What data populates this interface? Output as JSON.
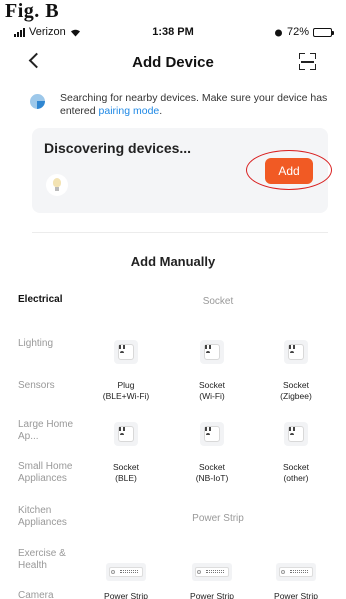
{
  "figure_label": "Fig. B",
  "status_bar": {
    "carrier": "Verizon",
    "time": "1:38 PM",
    "battery": "72%",
    "battery_level": 0.72
  },
  "nav": {
    "title": "Add Device",
    "back_icon": "chevron-left-icon",
    "scan_icon": "scan-icon"
  },
  "search": {
    "text": "Searching for nearby devices. Make sure your device has entered",
    "link": "pairing mode",
    "suffix": "."
  },
  "discover": {
    "title": "Discovering devices...",
    "device_icon": "light-bulb-icon",
    "add_label": "Add"
  },
  "manual": {
    "title": "Add Manually"
  },
  "categories": [
    {
      "label": "Electrical",
      "active": true
    },
    {
      "label": "Lighting"
    },
    {
      "label": "Sensors"
    },
    {
      "label": "Large Home Ap..."
    },
    {
      "label": "Small Home Appliances"
    },
    {
      "label": "Kitchen Appliances"
    },
    {
      "label": "Exercise & Health"
    },
    {
      "label": "Camera"
    }
  ],
  "sections": [
    {
      "title": "Socket",
      "devices": [
        {
          "name": "Plug",
          "sub": "(BLE+Wi-Fi)"
        },
        {
          "name": "Socket",
          "sub": "(Wi-Fi)"
        },
        {
          "name": "Socket",
          "sub": "(Zigbee)"
        },
        {
          "name": "Socket",
          "sub": "(BLE)"
        },
        {
          "name": "Socket",
          "sub": "(NB-IoT)"
        },
        {
          "name": "Socket",
          "sub": "(other)"
        }
      ]
    },
    {
      "title": "Power Strip",
      "devices": [
        {
          "name": "Power Strip"
        },
        {
          "name": "Power Strip"
        },
        {
          "name": "Power Strip"
        }
      ]
    }
  ],
  "colors": {
    "accent": "#f15a24",
    "link": "#1e88e5",
    "highlight": "#d92020",
    "card_bg": "#f4f5f7"
  }
}
